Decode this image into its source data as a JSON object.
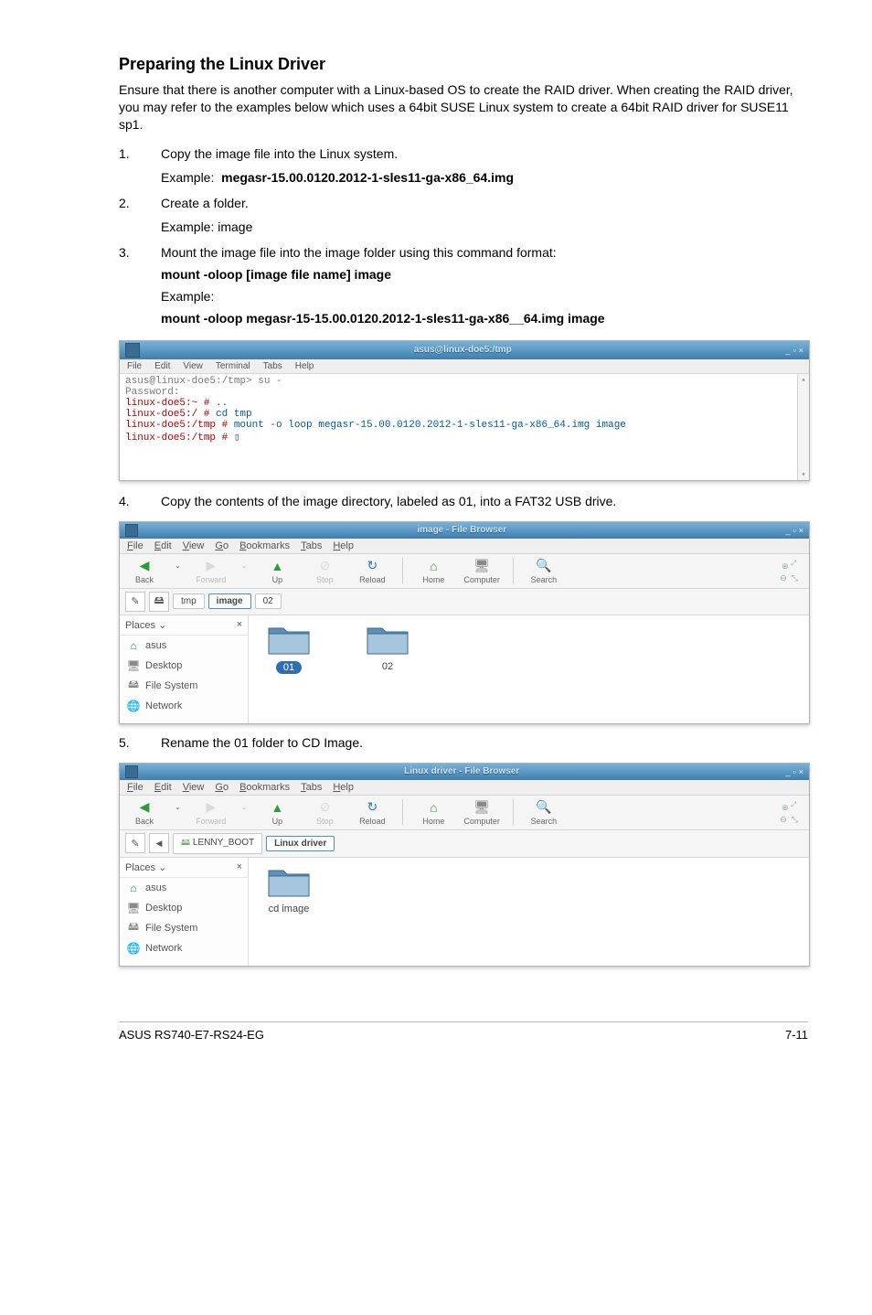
{
  "heading": "Preparing the Linux Driver",
  "intro": "Ensure that there is another computer with a Linux-based OS to create the RAID driver. When creating the RAID driver, you may refer to the examples below which uses a 64bit SUSE Linux system to create a 64bit RAID driver for SUSE11 sp1.",
  "steps": {
    "s1_num": "1.",
    "s1_text": "Copy the image file into the Linux system.",
    "s1_example_label": "Example:",
    "s1_example_value": "megasr-15.00.0120.2012-1-sles11-ga-x86_64.img",
    "s2_num": "2.",
    "s2_text": "Create a folder.",
    "s2_example": "Example: image",
    "s3_num": "3.",
    "s3_text": "Mount the image file into the image folder using this command format:",
    "s3_cmd": "mount -oloop [image file name] image",
    "s3_example_label": "Example:",
    "s3_example_value": "mount -oloop megasr-15-15.00.0120.2012-1-sles11-ga-x86__64.img image",
    "s4_num": "4.",
    "s4_text": "Copy the contents of the image directory, labeled as 01, into  a FAT32 USB drive.",
    "s5_num": "5.",
    "s5_text": "Rename the 01 folder to CD Image."
  },
  "terminal": {
    "title": "asus@linux-doe5:/tmp",
    "menu": [
      "File",
      "Edit",
      "View",
      "Terminal",
      "Tabs",
      "Help"
    ],
    "line1": "asus@linux-doe5:/tmp> su -",
    "line2": "Password:",
    "line3_prompt": "linux-doe5:~ #",
    "line3_cmd": " ..",
    "line4_prompt": "linux-doe5:/ #",
    "line4_cmd": " cd tmp",
    "line5_prompt": "linux-doe5:/tmp #",
    "line5_cmd": " mount -o loop megasr-15.00.0120.2012-1-sles11-ga-x86_64.img image",
    "line6_prompt": "linux-doe5:/tmp #",
    "line6_cursor": " ▯"
  },
  "browser1": {
    "title": "image - File Browser",
    "menu_file": "File",
    "menu_edit": "Edit",
    "menu_view": "View",
    "menu_go": "Go",
    "menu_bookmarks": "Bookmarks",
    "menu_tabs": "Tabs",
    "menu_help": "Help",
    "tb_back": "Back",
    "tb_forward": "Forward",
    "tb_up": "Up",
    "tb_stop": "Stop",
    "tb_reload": "Reload",
    "tb_home": "Home",
    "tb_computer": "Computer",
    "tb_search": "Search",
    "loc_tmp": "tmp",
    "loc_image": "image",
    "loc_02": "02",
    "places_hdr": "Places",
    "places_x": "×",
    "pl_asus": "asus",
    "pl_desktop": "Desktop",
    "pl_fs": "File System",
    "pl_network": "Network",
    "folder1": "01",
    "folder2": "02"
  },
  "browser2": {
    "title": "Linux driver - File Browser",
    "loc_lenny": "LENNY_BOOT",
    "loc_linuxdriver": "Linux driver",
    "folder1": "cd image"
  },
  "footer": {
    "left": "ASUS RS740-E7-RS24-EG",
    "right": "7-11"
  }
}
